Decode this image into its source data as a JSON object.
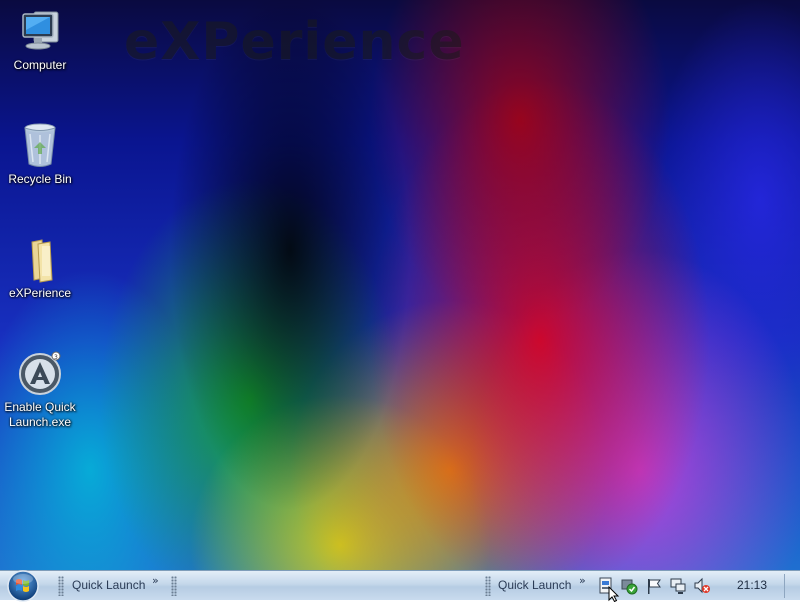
{
  "desktop": {
    "watermark": "eXPerience",
    "icons": [
      {
        "label": "Computer",
        "icon": "computer-icon"
      },
      {
        "label": "Recycle Bin",
        "icon": "recycle-bin-icon"
      },
      {
        "label": "eXPerience",
        "icon": "folder-icon"
      },
      {
        "label": "Enable Quick Launch.exe",
        "label_line1": "Enable Quick",
        "label_line2": "Launch.exe",
        "icon": "app-exe-icon"
      }
    ]
  },
  "taskbar": {
    "start_icon": "windows-orb-icon",
    "toolbars": [
      {
        "label": "Quick Launch"
      },
      {
        "label": "Quick Launch"
      }
    ],
    "tray_icons": [
      "safely-remove-hardware-icon",
      "security-shield-icon",
      "action-center-flag-icon",
      "network-icon",
      "volume-muted-icon"
    ],
    "clock": "21:13"
  },
  "colors": {
    "taskbar_top": "#e3eef8",
    "taskbar_bottom": "#c9dbee",
    "desktop_base": "#1830c0"
  }
}
